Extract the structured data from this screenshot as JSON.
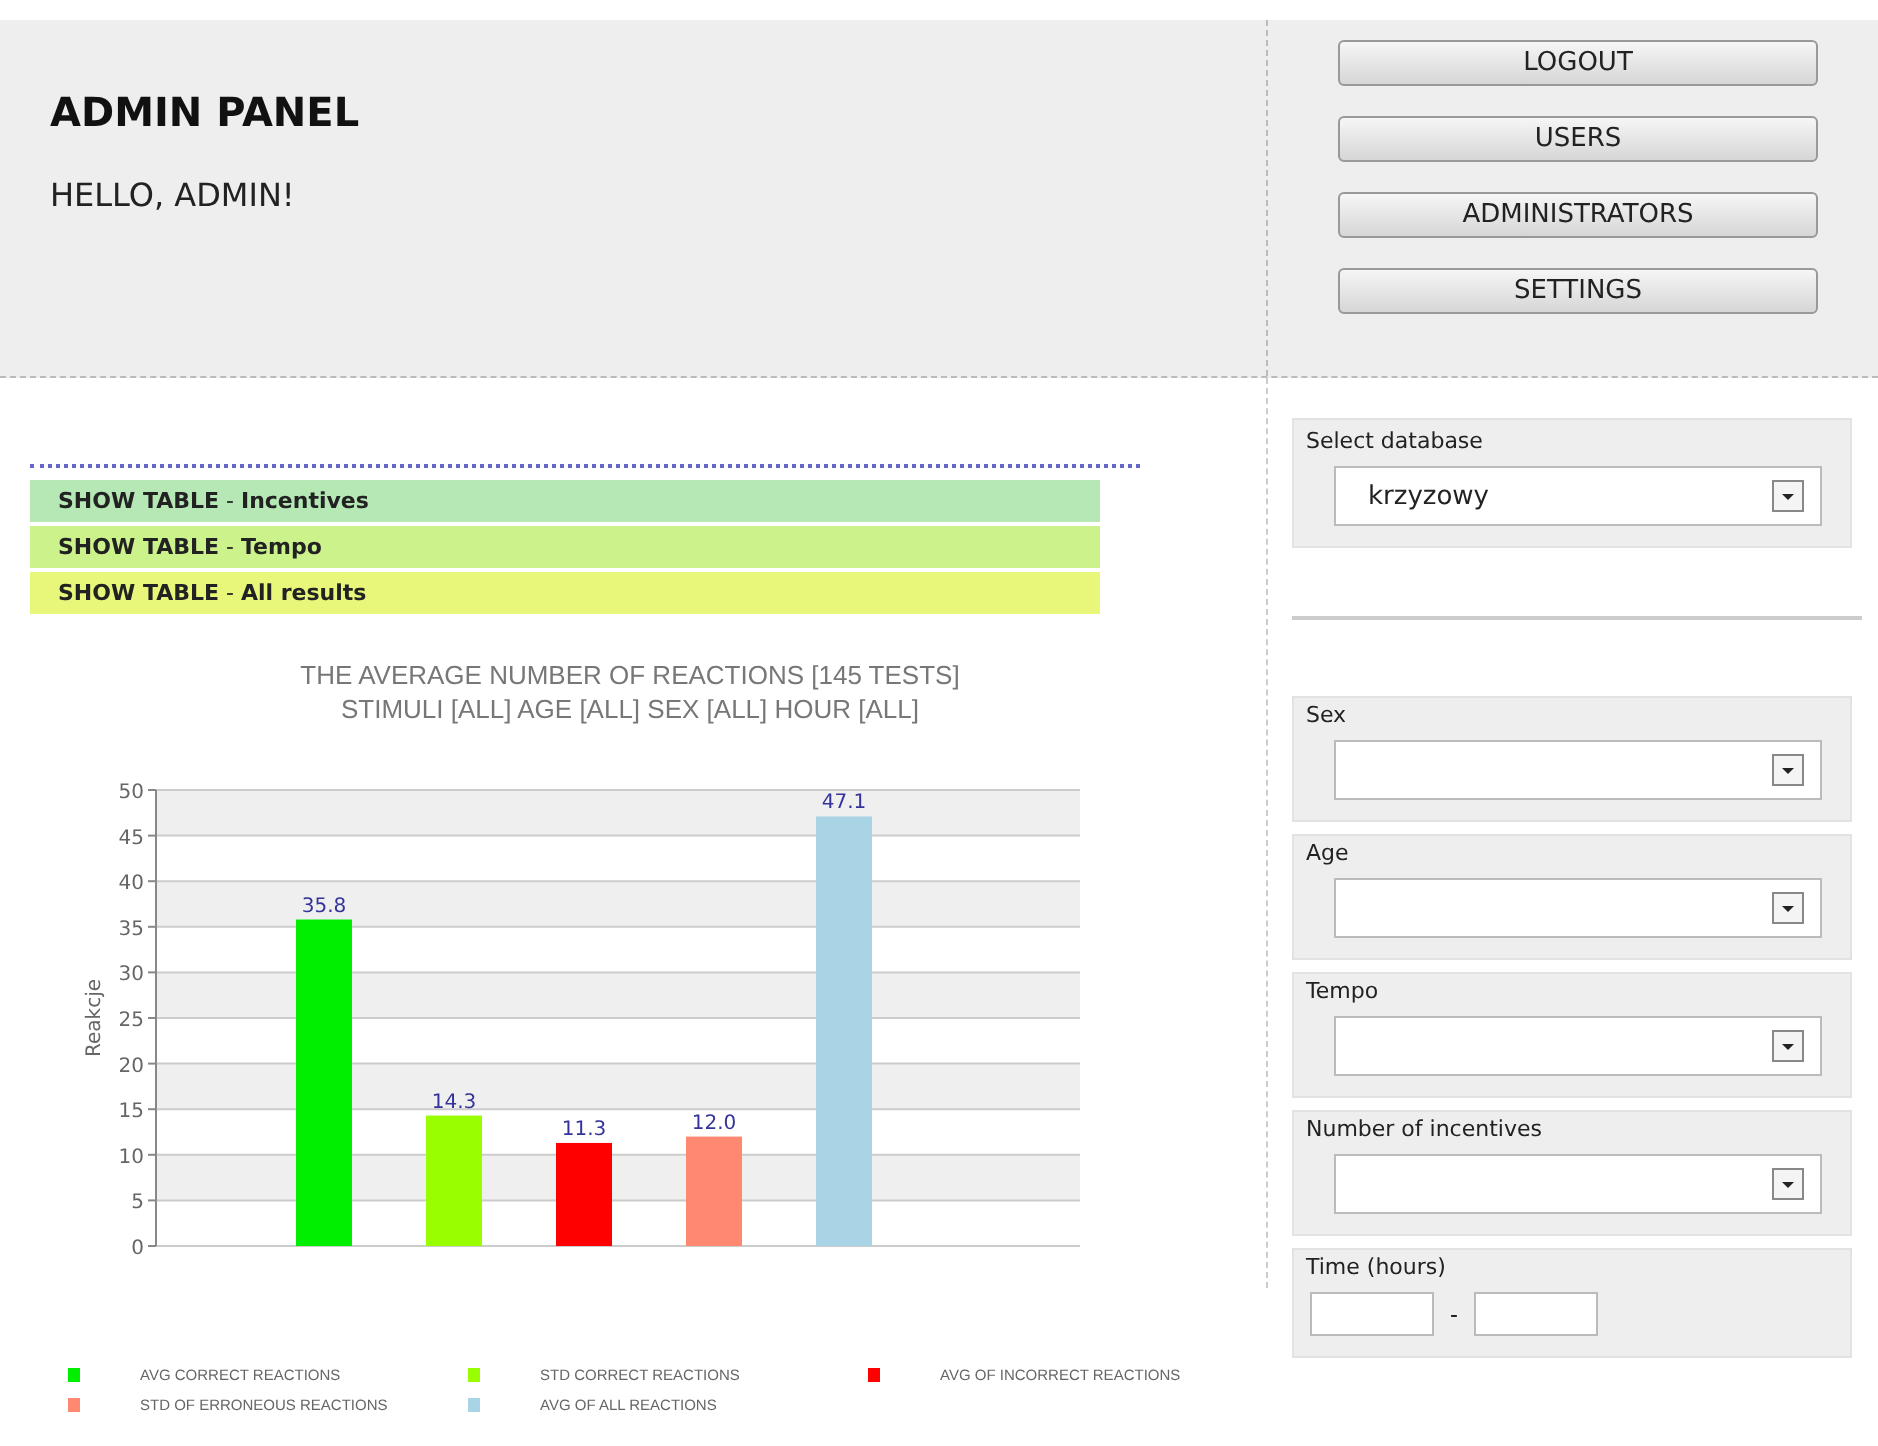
{
  "header": {
    "title": "ADMIN PANEL",
    "greeting": "HELLO, ADMIN!"
  },
  "nav_buttons": [
    "LOGOUT",
    "USERS",
    "ADMINISTRATORS",
    "SETTINGS"
  ],
  "show_tables": [
    {
      "label": "**SHOW TABLE** - **Incentives**",
      "color": "#b5e8b5"
    },
    {
      "label": "**SHOW TABLE** - **Tempo**",
      "color": "#ccf28c"
    },
    {
      "label": "**SHOW TABLE** - **All results**",
      "color": "#e8f77a"
    }
  ],
  "chart_title": [
    "THE AVERAGE NUMBER OF REACTIONS [145 TESTS]",
    "STIMULI [ALL] AGE [ALL] SEX [ALL] HOUR [ALL]"
  ],
  "chart_data": {
    "type": "bar",
    "ylabel": "Reakcje",
    "ylim": [
      0,
      50
    ],
    "yticks": [
      0,
      5,
      10,
      15,
      20,
      25,
      30,
      35,
      40,
      45,
      50
    ],
    "grid": true,
    "value_labels": [
      "35.8",
      "14.3",
      "11.3",
      "12.0",
      "47.1"
    ],
    "series": [
      {
        "name": "AVG CORRECT REACTIONS",
        "color": "#00ee00",
        "values": [
          35.8
        ]
      },
      {
        "name": "STD CORRECT REACTIONS",
        "color": "#99ff00",
        "values": [
          14.3
        ]
      },
      {
        "name": "AVG OF INCORRECT  REACTIONS",
        "color": "#ff0000",
        "values": [
          11.3
        ]
      },
      {
        "name": "STD OF ERRONEOUS REACTIONS",
        "color": "#ff8870",
        "values": [
          12.0
        ]
      },
      {
        "name": "AVG OF ALL REACTIONS",
        "color": "#a8d4e6",
        "values": [
          47.1
        ]
      }
    ]
  },
  "database": {
    "label": "Select database",
    "value": "krzyzowy"
  },
  "filters": [
    {
      "label": "Sex"
    },
    {
      "label": "Age"
    },
    {
      "label": "Tempo"
    },
    {
      "label": "Number of incentives"
    }
  ],
  "time": {
    "label": "Time (hours)",
    "separator": "-"
  }
}
